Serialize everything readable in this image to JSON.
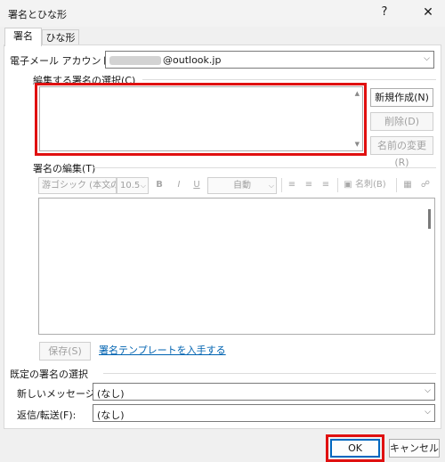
{
  "window": {
    "title": "署名とひな形",
    "help_glyph": "?",
    "close_glyph": "✕"
  },
  "tabs": [
    "署名",
    "ひな形"
  ],
  "account": {
    "label": "電子メール アカウント(A):",
    "value_suffix": "@outlook.jp"
  },
  "select_section": {
    "label": "編集する署名の選択(C)"
  },
  "side_buttons": {
    "new": "新規作成(N)",
    "delete": "削除(D)",
    "rename": "名前の変更(R)"
  },
  "edit_section": {
    "label": "署名の編集(T)"
  },
  "format_toolbar": {
    "font": "游ゴシック (本文の",
    "size": "10.5",
    "bold": "B",
    "italic": "I",
    "underline": "U",
    "color": "自動",
    "business_card": "名刺(B)"
  },
  "save_button": "保存(S)",
  "template_link": "署名テンプレートを入手する",
  "default_section": {
    "label": "既定の署名の選択",
    "new_messages_label": "新しいメッセージ(M):",
    "new_messages_value": "(なし)",
    "reply_label": "返信/転送(F):",
    "reply_value": "(なし)"
  },
  "footer": {
    "ok": "OK",
    "cancel": "キャンセル"
  },
  "colors": {
    "highlight": "#e01010",
    "link": "#0063b1"
  }
}
